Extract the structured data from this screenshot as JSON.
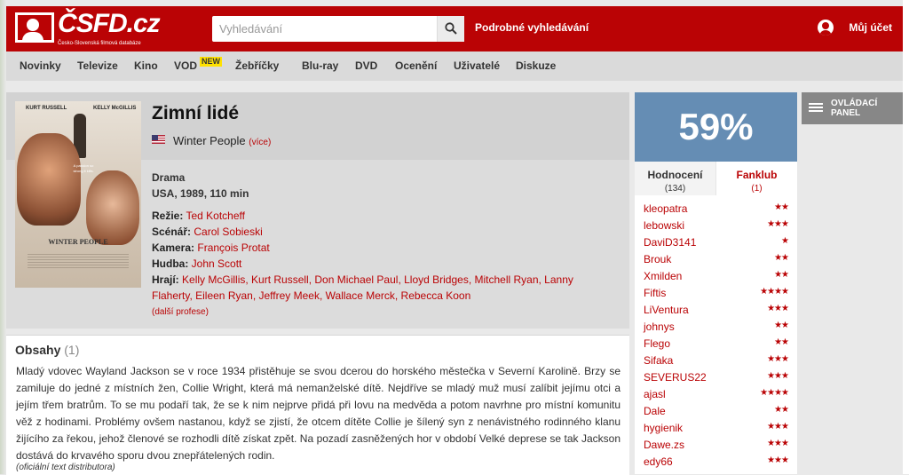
{
  "header": {
    "logo_text": "ČSFD.cz",
    "logo_subtitle": "Česko-Slovenská filmová databáze",
    "search_placeholder": "Vyhledávání",
    "advanced_search": "Podrobné vyhledávání",
    "account": "Můj účet"
  },
  "nav": {
    "items": [
      "Novinky",
      "Televize",
      "Kino",
      "VOD",
      "Žebříčky",
      "Blu-ray",
      "DVD",
      "Ocenění",
      "Uživatelé",
      "Diskuze"
    ],
    "vod_badge": "NEW"
  },
  "film": {
    "title": "Zimní lidé",
    "original_title": "Winter People",
    "more": "(více)",
    "genre": "Drama",
    "origin": "USA, 1989, 110 min",
    "credits": [
      {
        "label": "Režie:",
        "names": "Ted Kotcheff"
      },
      {
        "label": "Scénář:",
        "names": "Carol Sobieski"
      },
      {
        "label": "Kamera:",
        "names": "François Protat"
      },
      {
        "label": "Hudba:",
        "names": "John Scott"
      },
      {
        "label": "Hrají:",
        "names": "Kelly McGillis, Kurt Russell, Don Michael Paul, Lloyd Bridges, Mitchell Ryan, Lanny"
      },
      {
        "label": "",
        "names": "Flaherty, Eileen Ryan, Jeffrey Meek, Wallace Merck, Rebecca Koon"
      }
    ],
    "more_profession": "(další profese)",
    "poster": {
      "actor1": "KURT RUSSELL",
      "actor2": "KELLY McGILLIS",
      "tagline": "A passion so strong it kills.",
      "title": "WINTER PEOPLE"
    }
  },
  "plot": {
    "heading": "Obsahy",
    "count": "(1)",
    "text": "Mladý vdovec Wayland Jackson se v roce 1934 přistěhuje se svou dcerou do horského městečka v Severní Karolině. Brzy se zamiluje do jedné z místních žen, Collie Wright, která má nemanželské dítě. Nejdříve se mladý muž musí zalíbit jejímu otci a jejím třem bratrům. To se mu podaří tak, že se k nim nejprve přidá při lovu na medvěda a potom navrhne pro místní komunitu věž z hodinami. Problémy ovšem nastanou, když se zjistí, že otcem dítěte Collie je šílený syn z nenávistného rodinného klanu žijícího za řekou, jehož členové se rozhodli dítě získat zpět. Na pozadí zasněžených hor v období Velké deprese se tak Jackson dostává do krvavého sporu dvou znepřátelených rodin.",
    "source": "(oficiální text distributora)"
  },
  "rating": {
    "percent": "59%",
    "tab_ratings": "Hodnocení",
    "tab_ratings_count": "(134)",
    "tab_fanclub": "Fanklub",
    "tab_fanclub_count": "(1)",
    "users": [
      {
        "name": "kleopatra",
        "stars": 2
      },
      {
        "name": "lebowski",
        "stars": 3
      },
      {
        "name": "DaviD3141",
        "stars": 1
      },
      {
        "name": "Brouk",
        "stars": 2
      },
      {
        "name": "Xmilden",
        "stars": 2
      },
      {
        "name": "Fiftis",
        "stars": 4
      },
      {
        "name": "LiVentura",
        "stars": 3
      },
      {
        "name": "johnys",
        "stars": 2
      },
      {
        "name": "Flego",
        "stars": 2
      },
      {
        "name": "Sifaka",
        "stars": 3
      },
      {
        "name": "SEVERUS22",
        "stars": 3
      },
      {
        "name": "ajasl",
        "stars": 4
      },
      {
        "name": "Dale",
        "stars": 2
      },
      {
        "name": "hygienik",
        "stars": 3
      },
      {
        "name": "Dawe.zs",
        "stars": 3
      },
      {
        "name": "edy66",
        "stars": 3
      }
    ]
  },
  "panel": {
    "label_line1": "OVLÁDACÍ",
    "label_line2": "PANEL"
  },
  "colors": {
    "brand_red": "#ba0305",
    "rating_blue": "#658db4"
  }
}
